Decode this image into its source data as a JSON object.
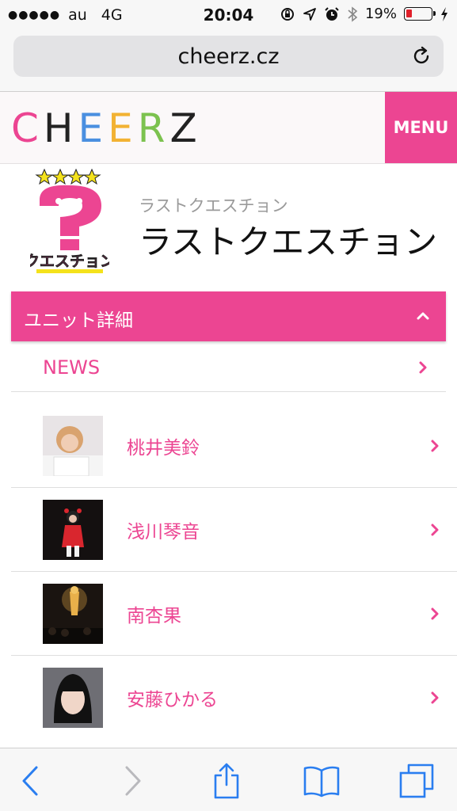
{
  "status_bar": {
    "carrier": "au",
    "network": "4G",
    "time": "20:04",
    "battery_percent": "19%",
    "battery_level": 0.19
  },
  "browser": {
    "url": "cheerz.cz"
  },
  "site": {
    "logo_letters": [
      {
        "char": "C",
        "color": "#ec4592"
      },
      {
        "char": "H",
        "color": "#222222"
      },
      {
        "char": "E",
        "color": "#4a8fe0"
      },
      {
        "char": "E",
        "color": "#f2b233"
      },
      {
        "char": "R",
        "color": "#7cc24f"
      },
      {
        "char": "Z",
        "color": "#222222"
      }
    ],
    "menu_label": "MENU",
    "accent_color": "#ec4592"
  },
  "unit": {
    "kana": "ラストクエスチョン",
    "name": "ラストクエスチョン",
    "logo_text": "クエスチョン"
  },
  "section": {
    "title": "ユニット詳細"
  },
  "news": {
    "label": "NEWS"
  },
  "members": [
    {
      "name": "桃井美鈴"
    },
    {
      "name": "浅川琴音"
    },
    {
      "name": "南杏果"
    },
    {
      "name": "安藤ひかる"
    }
  ]
}
